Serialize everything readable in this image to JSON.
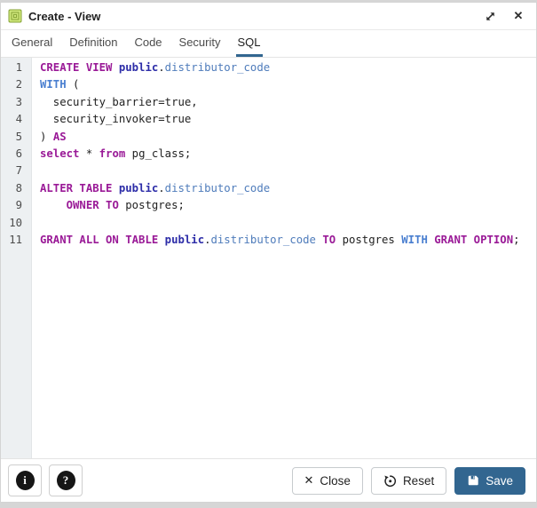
{
  "window": {
    "title": "Create - View",
    "icon": "view-icon"
  },
  "header_controls": {
    "expand_icon": "expand-diagonal-icon",
    "close_icon": "close-x-icon"
  },
  "tabs": {
    "items": [
      "General",
      "Definition",
      "Code",
      "Security",
      "SQL"
    ],
    "active": "SQL"
  },
  "editor": {
    "language": "sql",
    "lines": [
      {
        "num": 1,
        "tokens": [
          {
            "c": "kw",
            "t": "CREATE VIEW "
          },
          {
            "c": "ns",
            "t": "public"
          },
          {
            "c": "pl",
            "t": "."
          },
          {
            "c": "id",
            "t": "distributor_code"
          }
        ]
      },
      {
        "num": 2,
        "tokens": [
          {
            "c": "b",
            "t": "WITH"
          },
          {
            "c": "pl",
            "t": " ("
          }
        ]
      },
      {
        "num": 3,
        "tokens": [
          {
            "c": "pl",
            "t": "  security_barrier=true,"
          }
        ]
      },
      {
        "num": 4,
        "tokens": [
          {
            "c": "pl",
            "t": "  security_invoker=true"
          }
        ]
      },
      {
        "num": 5,
        "tokens": [
          {
            "c": "pl",
            "t": ") "
          },
          {
            "c": "kw",
            "t": "AS"
          }
        ]
      },
      {
        "num": 6,
        "tokens": [
          {
            "c": "kw",
            "t": "select"
          },
          {
            "c": "pl",
            "t": " * "
          },
          {
            "c": "kw",
            "t": "from"
          },
          {
            "c": "pl",
            "t": " pg_class;"
          }
        ]
      },
      {
        "num": 7,
        "tokens": []
      },
      {
        "num": 8,
        "tokens": [
          {
            "c": "kw",
            "t": "ALTER TABLE "
          },
          {
            "c": "ns",
            "t": "public"
          },
          {
            "c": "pl",
            "t": "."
          },
          {
            "c": "id",
            "t": "distributor_code"
          }
        ]
      },
      {
        "num": 9,
        "tokens": [
          {
            "c": "pl",
            "t": "    "
          },
          {
            "c": "kw",
            "t": "OWNER TO"
          },
          {
            "c": "pl",
            "t": " postgres;"
          }
        ]
      },
      {
        "num": 10,
        "tokens": []
      },
      {
        "num": 11,
        "tokens": [
          {
            "c": "kw",
            "t": "GRANT ALL ON TABLE "
          },
          {
            "c": "ns",
            "t": "public"
          },
          {
            "c": "pl",
            "t": "."
          },
          {
            "c": "id",
            "t": "distributor_code"
          },
          {
            "c": "pl",
            "t": " "
          },
          {
            "c": "kw",
            "t": "TO"
          },
          {
            "c": "pl",
            "t": " postgres "
          },
          {
            "c": "b",
            "t": "WITH"
          },
          {
            "c": "pl",
            "t": " "
          },
          {
            "c": "kw",
            "t": "GRANT OPTION"
          },
          {
            "c": "pl",
            "t": ";"
          }
        ]
      }
    ]
  },
  "footer": {
    "info_icon": "info-circle-icon",
    "help_icon": "question-circle-icon",
    "close_label": "Close",
    "reset_label": "Reset",
    "save_label": "Save"
  },
  "colors": {
    "accent": "#326690",
    "keyword": "#9a1a97",
    "builtin_keyword": "#4a7fd0",
    "schema_name": "#2d2da8",
    "identifier": "#4f7cbb",
    "plain_text": "#222222"
  }
}
